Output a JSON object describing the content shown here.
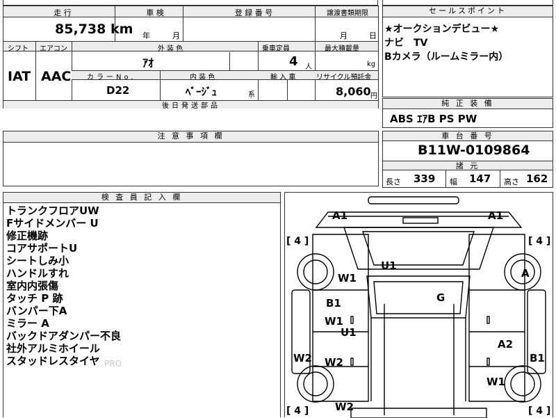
{
  "top_partial": {
    "text": ""
  },
  "header_row": {
    "mileage_label": "走 行",
    "inspection_label": "車 検",
    "registration_label": "登 録 番 号",
    "transfer_label": "譲渡書類期限",
    "selling_points_label": "セールスポイント"
  },
  "mileage": {
    "value": "85,738",
    "unit": "km"
  },
  "inspection": {
    "year_unit": "年",
    "month_unit": "月"
  },
  "transfer": {
    "month_unit": "月",
    "day_unit": "日"
  },
  "selling_points": [
    "★オークションデビュー★",
    "ナビ　TV",
    "Bカメラ（ルームミラー内）"
  ],
  "row2": {
    "shift_label": "シフト",
    "aircon_label": "エアコン",
    "exterior_label": "外 装 色",
    "capacity_label": "乗車定員",
    "max_load_label": "最大積載量",
    "shift_value": "IAT",
    "aircon_value": "AAC",
    "exterior_value": "ｱｵ",
    "capacity_value": "4",
    "capacity_unit": "人",
    "max_load_unit": "kg"
  },
  "row3": {
    "color_no_label": "カラーNo.",
    "interior_label": "内 装 色",
    "import_label": "輸 入 車",
    "recycle_label": "リサイクル預託金",
    "color_no_value": "D22",
    "interior_value": "ﾍﾞｰｼﾞｭ",
    "interior_suffix": "系",
    "recycle_value": "8,060",
    "recycle_unit": "円"
  },
  "later_parts": {
    "label": "後日発送部品"
  },
  "standard_equipment": {
    "label": "純 正 装 備",
    "value": "ABS ｴｱB PS PW"
  },
  "notes": {
    "label": "注 意 事 項 欄"
  },
  "chassis": {
    "label": "車 台 番 号",
    "value": "B11W-0109864"
  },
  "specs": {
    "label": "諸 元",
    "length_label": "長さ",
    "length_value": "339",
    "width_label": "幅",
    "width_value": "147",
    "height_label": "高さ",
    "height_value": "162"
  },
  "inspector": {
    "label": "検 査 員 記 入 欄",
    "items": [
      "トランクフロアUW",
      "Fサイドメンバー U",
      "修正機跡",
      "コアサポートU",
      "シートしみ小",
      "ハンドルすれ",
      "室内内張傷",
      "タッチ P 跡",
      "バンパー下A",
      "ミラー A",
      "バックドアダンパー不良",
      "社外アルミホイール",
      "スタッドレスタイヤ"
    ],
    "watermark": "PRO"
  },
  "diagram": {
    "tire_left_top": "[ 4 ]",
    "tire_right_top": "[ 4 ]",
    "tire_left_bottom": "[ 4 ]",
    "tire_right_bottom": "[ 4 ]",
    "marks": {
      "a1_left": "A1",
      "a1_right": "A1",
      "w1_left_front": "W1",
      "u1_roof": "U1",
      "a_right_wheel": "A",
      "b1_left": "B1",
      "g_center": "G",
      "w1_left_mid": "W1",
      "u1_mid": "U1",
      "a2_right": "A2",
      "w2_left": "W2",
      "w2_left_mid": "W2",
      "b1_right": "B1",
      "w1_right": "W1",
      "w2_bottom": "W2"
    }
  }
}
